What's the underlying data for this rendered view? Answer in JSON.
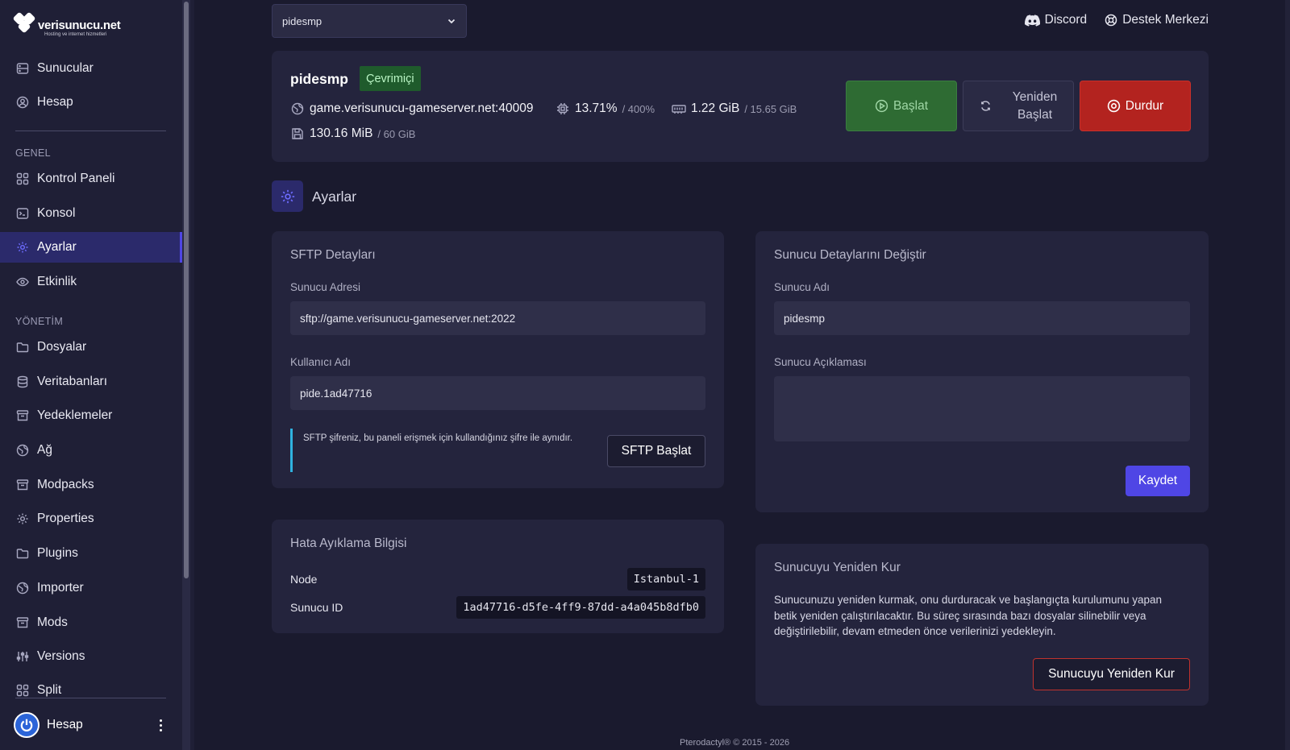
{
  "brand": {
    "name": "verisunucu.net",
    "tagline": "Hosting ve internet hizmetleri"
  },
  "sidebar": {
    "top_items": [
      {
        "label": "Sunucular",
        "icon": "server-icon"
      },
      {
        "label": "Hesap",
        "icon": "user-circle-icon"
      }
    ],
    "section_general": "GENEL",
    "general_items": [
      {
        "label": "Kontrol Paneli",
        "icon": "grid-icon"
      },
      {
        "label": "Konsol",
        "icon": "terminal-icon"
      },
      {
        "label": "Ayarlar",
        "icon": "gear-icon",
        "active": true
      },
      {
        "label": "Etkinlik",
        "icon": "eye-icon"
      }
    ],
    "section_manage": "YÖNETİM",
    "manage_items": [
      {
        "label": "Dosyalar",
        "icon": "folder-icon"
      },
      {
        "label": "Veritabanları",
        "icon": "database-icon"
      },
      {
        "label": "Yedeklemeler",
        "icon": "archive-icon"
      },
      {
        "label": "Ağ",
        "icon": "globe-icon"
      },
      {
        "label": "Modpacks",
        "icon": "archive-icon"
      },
      {
        "label": "Properties",
        "icon": "gear-icon"
      },
      {
        "label": "Plugins",
        "icon": "folder-icon"
      },
      {
        "label": "Importer",
        "icon": "globe-icon"
      },
      {
        "label": "Mods",
        "icon": "archive-icon"
      },
      {
        "label": "Versions",
        "icon": "sliders-icon"
      },
      {
        "label": "Split",
        "icon": "grid-icon"
      }
    ],
    "footer_label": "Hesap"
  },
  "topbar": {
    "server_select_value": "pidesmp",
    "discord_label": "Discord",
    "support_label": "Destek Merkezi"
  },
  "server": {
    "name": "pidesmp",
    "status": "Çevrimiçi",
    "address": "game.verisunucu-gameserver.net:40009",
    "cpu": "13.71%",
    "cpu_limit": "/ 400%",
    "memory": "1.22 GiB",
    "memory_limit": "/ 15.65 GiB",
    "disk": "130.16 MiB",
    "disk_limit": "/ 60 GiB",
    "start_label": "Başlat",
    "restart_label_1": "Yeniden",
    "restart_label_2": "Başlat",
    "stop_label": "Durdur"
  },
  "page": {
    "title": "Ayarlar"
  },
  "sftp": {
    "title": "SFTP Detayları",
    "address_label": "Sunucu Adresi",
    "address_value": "sftp://game.verisunucu-gameserver.net:2022",
    "username_label": "Kullanıcı Adı",
    "username_value": "pide.1ad47716",
    "note": "SFTP şifreniz, bu paneli erişmek için kullandığınız şifre ile aynıdır.",
    "launch_label": "SFTP Başlat"
  },
  "debug": {
    "title": "Hata Ayıklama Bilgisi",
    "node_label": "Node",
    "node_value": "Istanbul-1",
    "id_label": "Sunucu ID",
    "id_value": "1ad47716-d5fe-4ff9-87dd-a4a045b8dfb0"
  },
  "details": {
    "title": "Sunucu Detaylarını Değiştir",
    "name_label": "Sunucu Adı",
    "name_value": "pidesmp",
    "desc_label": "Sunucu Açıklaması",
    "desc_value": "",
    "save_label": "Kaydet"
  },
  "reinstall": {
    "title": "Sunucuyu Yeniden Kur",
    "text": "Sunucunuzu yeniden kurmak, onu durduracak ve başlangıçta kurulumunu yapan betik yeniden çalıştırılacaktır. Bu süreç sırasında bazı dosyalar silinebilir veya değiştirilebilir, devam etmeden önce verilerinizi yedekleyin.",
    "button_label": "Sunucuyu Yeniden Kur"
  },
  "footer": {
    "copyright": "Pterodactyl® © 2015 - 2026"
  },
  "colors": {
    "accent": "#4f46e5",
    "online": "#1f5b2c",
    "start": "#2e6b33",
    "stop": "#b3231f",
    "background": "#1a1a2e",
    "card": "#24243d"
  }
}
